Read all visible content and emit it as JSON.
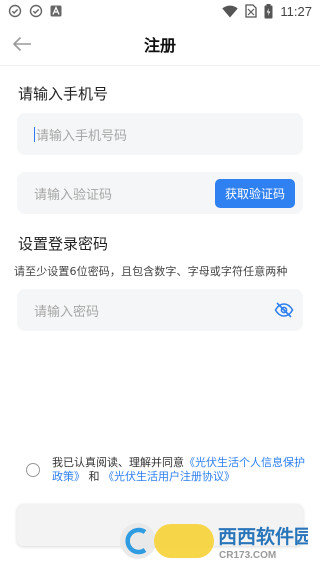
{
  "status_bar": {
    "time": "11:27"
  },
  "header": {
    "title": "注册"
  },
  "phone": {
    "label": "请输入手机号",
    "placeholder": "请输入手机号码"
  },
  "code": {
    "placeholder": "请输入验证码",
    "button_label": "获取验证码"
  },
  "password": {
    "label": "设置登录密码",
    "hint": "请至少设置6位密码，且包含数字、字母或字符任意两种",
    "placeholder": "请输入密码"
  },
  "agreement": {
    "prefix": "我已认真阅读、理解并同意",
    "link1": "《光伏生活个人信息保护政策》",
    "connector": "和",
    "link2": "《光伏生活用户注册协议》"
  },
  "watermark": {
    "brand": "西西软件园",
    "url": "CR173.COM"
  },
  "colors": {
    "accent": "#2f80f0"
  }
}
